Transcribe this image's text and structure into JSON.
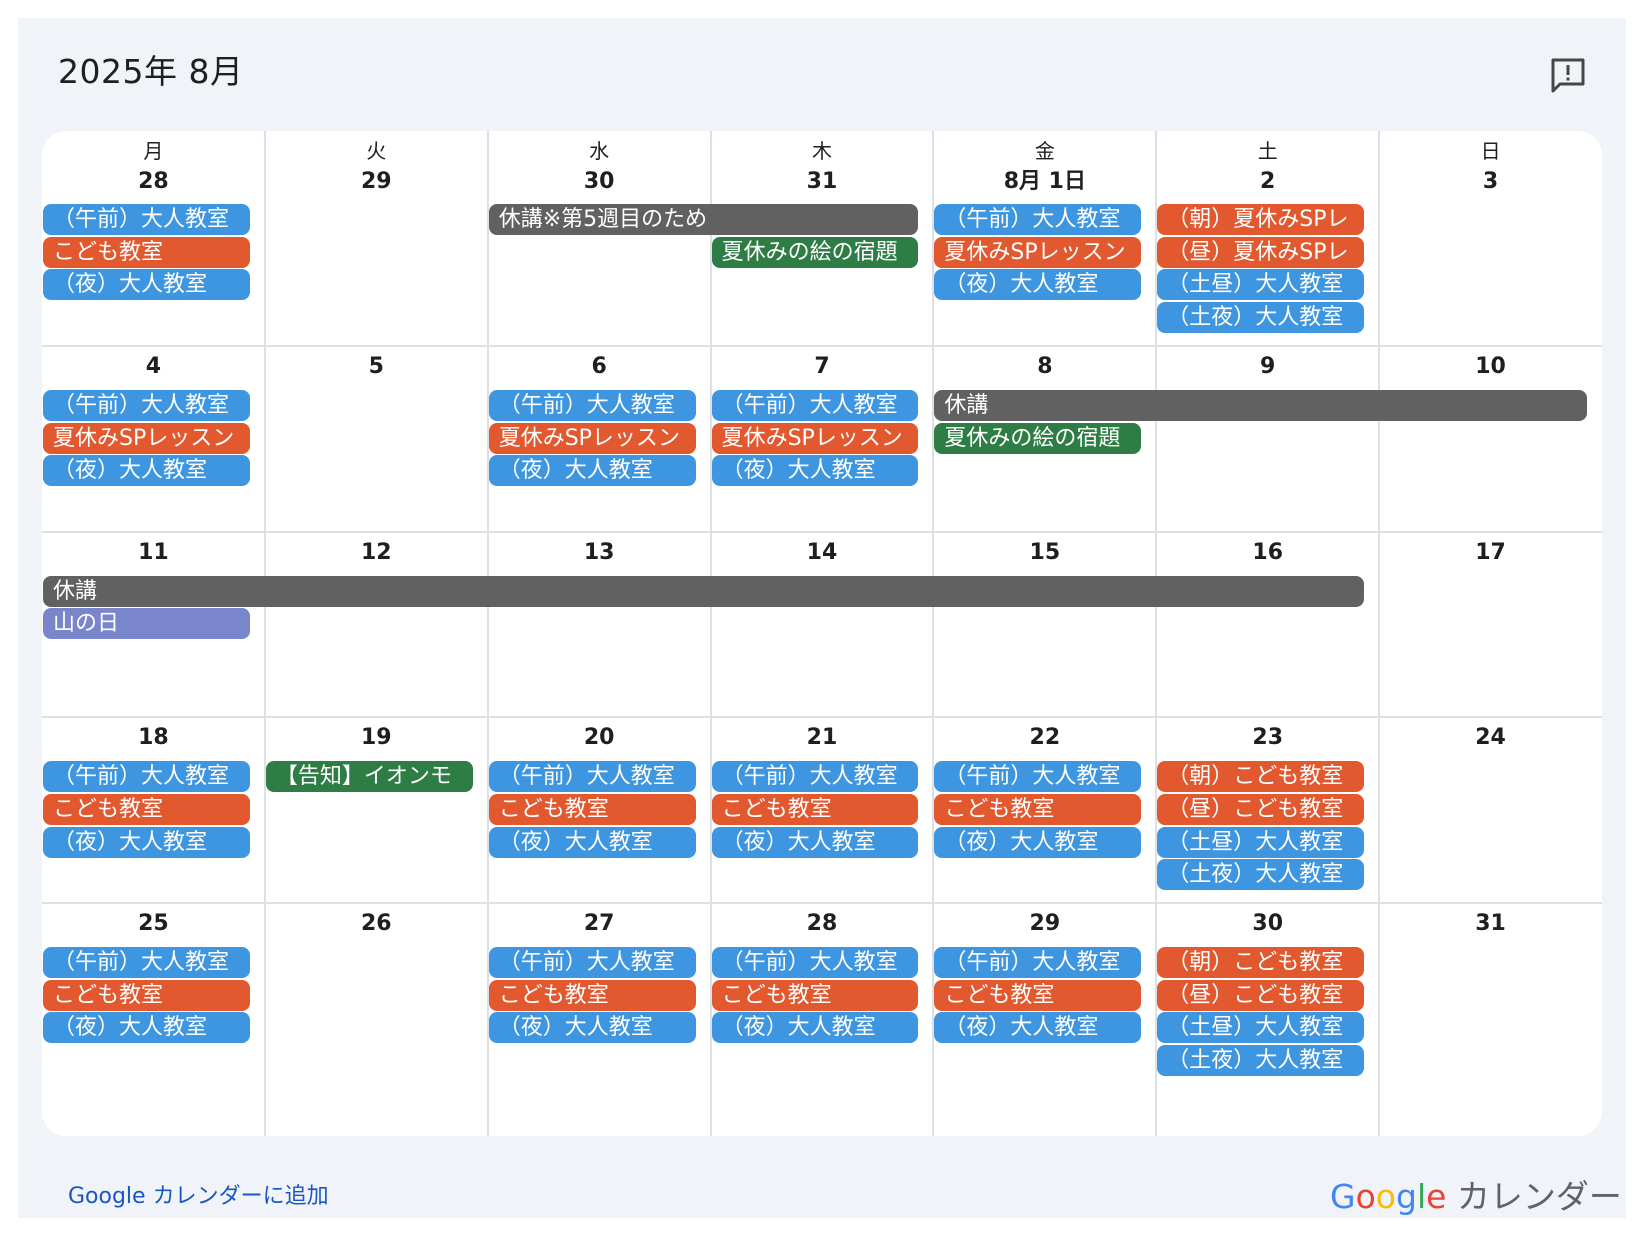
{
  "header": {
    "title": "2025年 8月"
  },
  "icons": {
    "feedback": "feedback-icon"
  },
  "weekdays": [
    "月",
    "火",
    "水",
    "木",
    "金",
    "土",
    "日"
  ],
  "weeks": [
    [
      "28",
      "29",
      "30",
      "31",
      "8月 1日",
      "2",
      "3"
    ],
    [
      "4",
      "5",
      "6",
      "7",
      "8",
      "9",
      "10"
    ],
    [
      "11",
      "12",
      "13",
      "14",
      "15",
      "16",
      "17"
    ],
    [
      "18",
      "19",
      "20",
      "21",
      "22",
      "23",
      "24"
    ],
    [
      "25",
      "26",
      "27",
      "28",
      "29",
      "30",
      "31"
    ]
  ],
  "colors": {
    "blue": "#3f96e0",
    "red": "#e2582f",
    "green": "#2e7d45",
    "gray": "#616161",
    "purple": "#7a86cb"
  },
  "events": [
    {
      "week": 0,
      "start": 0,
      "span": 1,
      "slot": 0,
      "color": "blue",
      "title": "（午前）大人教室"
    },
    {
      "week": 0,
      "start": 0,
      "span": 1,
      "slot": 1,
      "color": "red",
      "title": "こども教室"
    },
    {
      "week": 0,
      "start": 0,
      "span": 1,
      "slot": 2,
      "color": "blue",
      "title": "（夜）大人教室"
    },
    {
      "week": 0,
      "start": 2,
      "span": 2,
      "slot": 0,
      "color": "gray",
      "title": "休講※第5週目のため"
    },
    {
      "week": 0,
      "start": 3,
      "span": 1,
      "slot": 1,
      "color": "green",
      "title": "夏休みの絵の宿題"
    },
    {
      "week": 0,
      "start": 4,
      "span": 1,
      "slot": 0,
      "color": "blue",
      "title": "（午前）大人教室"
    },
    {
      "week": 0,
      "start": 4,
      "span": 1,
      "slot": 1,
      "color": "red",
      "title": "夏休みSPレッスン"
    },
    {
      "week": 0,
      "start": 4,
      "span": 1,
      "slot": 2,
      "color": "blue",
      "title": "（夜）大人教室"
    },
    {
      "week": 0,
      "start": 5,
      "span": 1,
      "slot": 0,
      "color": "red",
      "title": "（朝）夏休みSPレ"
    },
    {
      "week": 0,
      "start": 5,
      "span": 1,
      "slot": 1,
      "color": "red",
      "title": "（昼）夏休みSPレ"
    },
    {
      "week": 0,
      "start": 5,
      "span": 1,
      "slot": 2,
      "color": "blue",
      "title": "（土昼）大人教室"
    },
    {
      "week": 0,
      "start": 5,
      "span": 1,
      "slot": 3,
      "color": "blue",
      "title": "（土夜）大人教室"
    },
    {
      "week": 1,
      "start": 0,
      "span": 1,
      "slot": 0,
      "color": "blue",
      "title": "（午前）大人教室"
    },
    {
      "week": 1,
      "start": 0,
      "span": 1,
      "slot": 1,
      "color": "red",
      "title": "夏休みSPレッスン"
    },
    {
      "week": 1,
      "start": 0,
      "span": 1,
      "slot": 2,
      "color": "blue",
      "title": "（夜）大人教室"
    },
    {
      "week": 1,
      "start": 2,
      "span": 1,
      "slot": 0,
      "color": "blue",
      "title": "（午前）大人教室"
    },
    {
      "week": 1,
      "start": 2,
      "span": 1,
      "slot": 1,
      "color": "red",
      "title": "夏休みSPレッスン"
    },
    {
      "week": 1,
      "start": 2,
      "span": 1,
      "slot": 2,
      "color": "blue",
      "title": "（夜）大人教室"
    },
    {
      "week": 1,
      "start": 3,
      "span": 1,
      "slot": 0,
      "color": "blue",
      "title": "（午前）大人教室"
    },
    {
      "week": 1,
      "start": 3,
      "span": 1,
      "slot": 1,
      "color": "red",
      "title": "夏休みSPレッスン"
    },
    {
      "week": 1,
      "start": 3,
      "span": 1,
      "slot": 2,
      "color": "blue",
      "title": "（夜）大人教室"
    },
    {
      "week": 1,
      "start": 4,
      "span": 3,
      "slot": 0,
      "color": "gray",
      "title": "休講"
    },
    {
      "week": 1,
      "start": 4,
      "span": 1,
      "slot": 1,
      "color": "green",
      "title": "夏休みの絵の宿題"
    },
    {
      "week": 2,
      "start": 0,
      "span": 6,
      "slot": 0,
      "color": "gray",
      "title": "休講"
    },
    {
      "week": 2,
      "start": 0,
      "span": 1,
      "slot": 1,
      "color": "purple",
      "title": "山の日"
    },
    {
      "week": 3,
      "start": 0,
      "span": 1,
      "slot": 0,
      "color": "blue",
      "title": "（午前）大人教室"
    },
    {
      "week": 3,
      "start": 0,
      "span": 1,
      "slot": 1,
      "color": "red",
      "title": "こども教室"
    },
    {
      "week": 3,
      "start": 0,
      "span": 1,
      "slot": 2,
      "color": "blue",
      "title": "（夜）大人教室"
    },
    {
      "week": 3,
      "start": 1,
      "span": 1,
      "slot": 0,
      "color": "green",
      "title": "【告知】イオンモ"
    },
    {
      "week": 3,
      "start": 2,
      "span": 1,
      "slot": 0,
      "color": "blue",
      "title": "（午前）大人教室"
    },
    {
      "week": 3,
      "start": 2,
      "span": 1,
      "slot": 1,
      "color": "red",
      "title": "こども教室"
    },
    {
      "week": 3,
      "start": 2,
      "span": 1,
      "slot": 2,
      "color": "blue",
      "title": "（夜）大人教室"
    },
    {
      "week": 3,
      "start": 3,
      "span": 1,
      "slot": 0,
      "color": "blue",
      "title": "（午前）大人教室"
    },
    {
      "week": 3,
      "start": 3,
      "span": 1,
      "slot": 1,
      "color": "red",
      "title": "こども教室"
    },
    {
      "week": 3,
      "start": 3,
      "span": 1,
      "slot": 2,
      "color": "blue",
      "title": "（夜）大人教室"
    },
    {
      "week": 3,
      "start": 4,
      "span": 1,
      "slot": 0,
      "color": "blue",
      "title": "（午前）大人教室"
    },
    {
      "week": 3,
      "start": 4,
      "span": 1,
      "slot": 1,
      "color": "red",
      "title": "こども教室"
    },
    {
      "week": 3,
      "start": 4,
      "span": 1,
      "slot": 2,
      "color": "blue",
      "title": "（夜）大人教室"
    },
    {
      "week": 3,
      "start": 5,
      "span": 1,
      "slot": 0,
      "color": "red",
      "title": "（朝）こども教室"
    },
    {
      "week": 3,
      "start": 5,
      "span": 1,
      "slot": 1,
      "color": "red",
      "title": "（昼）こども教室"
    },
    {
      "week": 3,
      "start": 5,
      "span": 1,
      "slot": 2,
      "color": "blue",
      "title": "（土昼）大人教室"
    },
    {
      "week": 3,
      "start": 5,
      "span": 1,
      "slot": 3,
      "color": "blue",
      "title": "（土夜）大人教室"
    },
    {
      "week": 4,
      "start": 0,
      "span": 1,
      "slot": 0,
      "color": "blue",
      "title": "（午前）大人教室"
    },
    {
      "week": 4,
      "start": 0,
      "span": 1,
      "slot": 1,
      "color": "red",
      "title": "こども教室"
    },
    {
      "week": 4,
      "start": 0,
      "span": 1,
      "slot": 2,
      "color": "blue",
      "title": "（夜）大人教室"
    },
    {
      "week": 4,
      "start": 2,
      "span": 1,
      "slot": 0,
      "color": "blue",
      "title": "（午前）大人教室"
    },
    {
      "week": 4,
      "start": 2,
      "span": 1,
      "slot": 1,
      "color": "red",
      "title": "こども教室"
    },
    {
      "week": 4,
      "start": 2,
      "span": 1,
      "slot": 2,
      "color": "blue",
      "title": "（夜）大人教室"
    },
    {
      "week": 4,
      "start": 3,
      "span": 1,
      "slot": 0,
      "color": "blue",
      "title": "（午前）大人教室"
    },
    {
      "week": 4,
      "start": 3,
      "span": 1,
      "slot": 1,
      "color": "red",
      "title": "こども教室"
    },
    {
      "week": 4,
      "start": 3,
      "span": 1,
      "slot": 2,
      "color": "blue",
      "title": "（夜）大人教室"
    },
    {
      "week": 4,
      "start": 4,
      "span": 1,
      "slot": 0,
      "color": "blue",
      "title": "（午前）大人教室"
    },
    {
      "week": 4,
      "start": 4,
      "span": 1,
      "slot": 1,
      "color": "red",
      "title": "こども教室"
    },
    {
      "week": 4,
      "start": 4,
      "span": 1,
      "slot": 2,
      "color": "blue",
      "title": "（夜）大人教室"
    },
    {
      "week": 4,
      "start": 5,
      "span": 1,
      "slot": 0,
      "color": "red",
      "title": "（朝）こども教室"
    },
    {
      "week": 4,
      "start": 5,
      "span": 1,
      "slot": 1,
      "color": "red",
      "title": "（昼）こども教室"
    },
    {
      "week": 4,
      "start": 5,
      "span": 1,
      "slot": 2,
      "color": "blue",
      "title": "（土昼）大人教室"
    },
    {
      "week": 4,
      "start": 5,
      "span": 1,
      "slot": 3,
      "color": "blue",
      "title": "（土夜）大人教室"
    }
  ],
  "footer": {
    "add_link": "Google カレンダーに追加",
    "brand_google": "Google",
    "brand_suffix": " カレンダー"
  }
}
